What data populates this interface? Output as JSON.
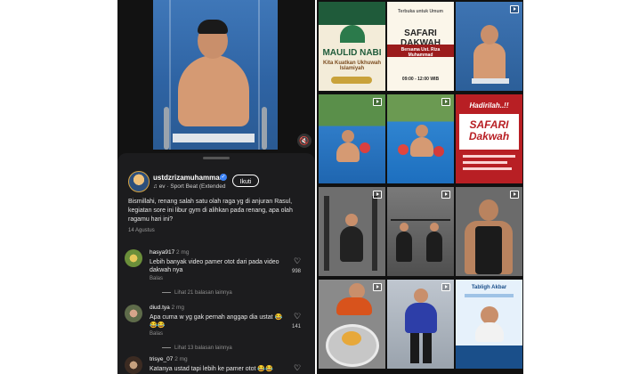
{
  "left_post": {
    "mute_icon": "speaker-off-icon",
    "username": "ustdzrizamuhammad",
    "audio": "ev · Sport Beat (Extended",
    "follow_label": "Ikuti",
    "caption": "Bismillahi, renang salah satu olah raga yg di anjuran Rasul, kegiatan sore ini libur gym di alihkan pada renang, apa olah ragamu hari ini?",
    "date": "14 Agustus",
    "comments": [
      {
        "user": "hasya917",
        "time": "2 mg",
        "text": "Lebih banyak video pamer otot dari pada video dakwah nya",
        "reply": "Balas",
        "more": "Lihat 21 balasan lainnya",
        "likes": "998"
      },
      {
        "user": "diud.tya",
        "time": "2 mg",
        "text": "Apa cuma w yg gak pernah anggap dia ustat 😂😂😂",
        "reply": "Balas",
        "more": "Lihat 13 balasan lainnya",
        "likes": "141"
      },
      {
        "user": "trisye_07",
        "time": "2 mg",
        "text": "Katanya ustad tapi lebih ke pamer otot 😂😂"
      }
    ]
  },
  "grid": {
    "posters": {
      "maulid_title": "MAULID NABI",
      "maulid_sub": "Kita Kuatkan Ukhuwah Islamiyah",
      "safari_title": "SAFARI DAKWAH",
      "safari_top": "Terbuka untuk Umum",
      "safari_speaker": "Bersama Ust. Riza Muhammad",
      "safari_time": "09:00 - 12:00 WIB",
      "hadirilah": "Hadirilah..!!",
      "safari2": "SAFARI Dakwah",
      "tabligh": "Tabligh Akbar"
    }
  }
}
